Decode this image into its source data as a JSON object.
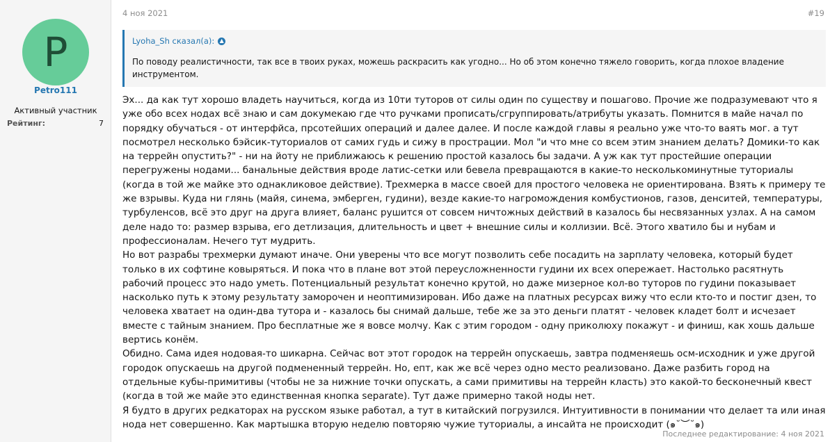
{
  "user": {
    "avatar_letter": "P",
    "name": "Petro111",
    "title": "Активный участник",
    "rating_label": "Рейтинг:",
    "rating_value": "7"
  },
  "post": {
    "date": "4 ноя 2021",
    "number": "#19",
    "edited": "Последнее редактирование: 4 ноя 2021"
  },
  "quote": {
    "author": "Lyoha_Sh сказал(а):",
    "text": "По поводу реалистичности, так все в твоих руках, можешь раскрасить как угодно... Но об этом конечно тяжело говорить, когда плохое владение инструментом."
  },
  "colors": {
    "accent": "#2577b1",
    "avatar_bg": "#66cc99",
    "muted": "#8c8c8c"
  },
  "message": {
    "p1": "Эх... да как тут хорошо владеть научиться, когда из 10ти туторов от силы один по существу и пошагово. Прочие же подразумевают что я уже обо всех нодах всё знаю и сам докумекаю где что ручками прописать/сгруппировать/атрибуты указать. Помнится в майе начал по порядку обучаться - от интерфйса, прсотейших операций и далее далее. И после каждой главы я реально уже что-то ваять мог. а тут посмотрел несколько бэйсик-туториалов от самих гудь и сижу в прострации. Мол \"и что мне со всем этим знанием делать? Домики-то как на террейн опустить?\" - ни на йоту не приближаюсь к решению простой казалось бы задачи. А уж как тут простейшие операции перегружены нодами... банальные действия вроде латис-сетки или бевела превращаются в какие-то несколькоминутные туториалы (когда в той же майке это однакликовое действие). Трехмерка в массе своей для простого человека не ориентирована. Взять к примеру те же взрывы. Куда ни глянь (майя, синема, эмберген, гудини), везде какие-то нагромождения комбустионов, газов, денситей, температуры, турбуленсов, всё это друг на друга влияет, баланс рушится от совсем ничтожных действий в казалось бы несвязанных узлах. А на самом деле надо то: размер взрыва, его детлизация, длительность и цвет + внешние силы и коллизии. Всё. Этого хватило бы и нубам и профессионалам. Нечего тут мудрить.",
    "p2": "Но вот разрабы трехмерки думают иначе. Они уверены что все могут позволить себе посадить на зарплату человека, который будет только в их софтине ковыряться. И пока что в плане вот этой переусложненности гудини их всех опережает. Настолько расятнуть рабочий процесс это надо уметь. Потенциальный результат конечно крутой, но даже мизерное кол-во туторов по гудини показывает насколько путь к этому результату заморочен и неоптимизирован. Ибо даже на платных ресурсах вижу что если кто-то и постиг дзен, то человека хватает на один-два тутора и - казалось бы снимай дальше, тебе же за это деньги платят - человек кладет болт и исчезает вместе с тайным знанием. Про бесплатные же я вовсе молчу. Как с этим городом - одну приколюху покажут - и финиш, как хошь дальше вертись конём.",
    "p3": "Обидно. Сама идея нодовая-то шикарна. Сейчас вот этот городок на террейн опускаешь, завтра подменяешь осм-исходник и уже другой городок опускаешь на другой подмененный террейн. Но, епт, как же всё через одно место реализовано. Даже разбить город на отдельные кубы-примитивы (чтобы не за нижние точки опускать, а сами примитивы на террейн класть) это какой-то бесконечный квест (когда в той же майе это единственная кнопка separate). Тут даже примерно такой ноды нет.",
    "p4": "Я будто в других редкаторах на русском языке работал, а тут в китайский погрузился. Интуитивности в понимании что делает та или иная нода нет совершенно. Как мартышка вторую неделю повторяю чужие туториалы, а инсайта не происходит (๑˘︶˘๑)"
  }
}
